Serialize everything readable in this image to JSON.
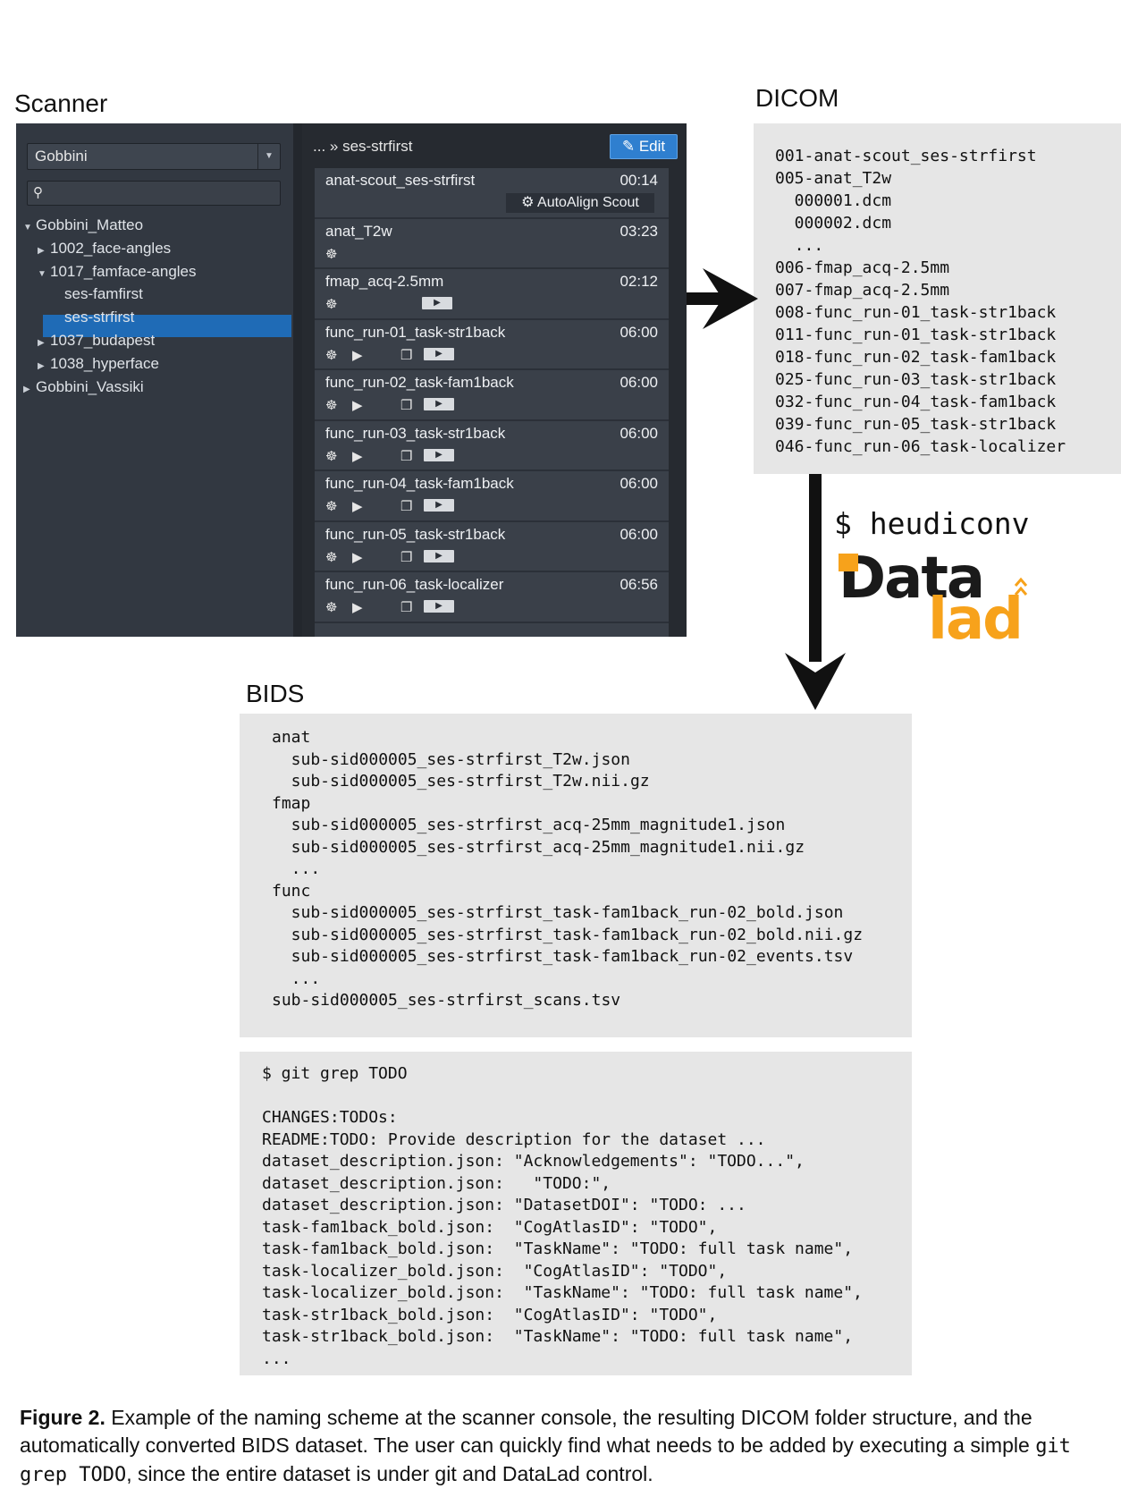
{
  "labels": {
    "scanner": "Scanner",
    "dicom": "DICOM",
    "bids": "BIDS",
    "command": "$ heudiconv"
  },
  "logo": {
    "word1": "Data",
    "word2": "lad",
    "color": "#f7a21b"
  },
  "scanner": {
    "combo_value": "Gobbini",
    "tree": [
      {
        "label": "Gobbini_Matteo",
        "expanded": true
      },
      {
        "label": "1002_face-angles",
        "expanded": false
      },
      {
        "label": "1017_famface-angles",
        "expanded": true
      },
      {
        "label": "ses-famfirst"
      },
      {
        "label": "ses-strfirst",
        "selected": true
      },
      {
        "label": "1037_budapest",
        "expanded": false
      },
      {
        "label": "1038_hyperface",
        "expanded": false
      },
      {
        "label": "Gobbini_Vassiki",
        "expanded": false
      }
    ],
    "breadcrumb": "... » ses-strfirst",
    "edit_label": "Edit",
    "autoalign_label": "AutoAlign Scout",
    "protocols": [
      {
        "name": "anat-scout_ses-strfirst",
        "time": "00:14"
      },
      {
        "name": "anat_T2w",
        "time": "03:23"
      },
      {
        "name": "fmap_acq-2.5mm",
        "time": "02:12"
      },
      {
        "name": "func_run-01_task-str1back",
        "time": "06:00"
      },
      {
        "name": "func_run-02_task-fam1back",
        "time": "06:00"
      },
      {
        "name": "func_run-03_task-str1back",
        "time": "06:00"
      },
      {
        "name": "func_run-04_task-fam1back",
        "time": "06:00"
      },
      {
        "name": "func_run-05_task-str1back",
        "time": "06:00"
      },
      {
        "name": "func_run-06_task-localizer",
        "time": "06:56"
      }
    ]
  },
  "dicom_lines": [
    "001-anat-scout_ses-strfirst",
    "005-anat_T2w",
    "  000001.dcm",
    "  000002.dcm",
    "  ...",
    "006-fmap_acq-2.5mm",
    "007-fmap_acq-2.5mm",
    "008-func_run-01_task-str1back",
    "011-func_run-01_task-str1back",
    "018-func_run-02_task-fam1back",
    "025-func_run-03_task-str1back",
    "032-func_run-04_task-fam1back",
    "039-func_run-05_task-str1back",
    "046-func_run-06_task-localizer"
  ],
  "bids_lines": [
    "anat",
    "  sub-sid000005_ses-strfirst_T2w.json",
    "  sub-sid000005_ses-strfirst_T2w.nii.gz",
    "fmap",
    "  sub-sid000005_ses-strfirst_acq-25mm_magnitude1.json",
    "  sub-sid000005_ses-strfirst_acq-25mm_magnitude1.nii.gz",
    "  ...",
    "func",
    "  sub-sid000005_ses-strfirst_task-fam1back_run-02_bold.json",
    "  sub-sid000005_ses-strfirst_task-fam1back_run-02_bold.nii.gz",
    "  sub-sid000005_ses-strfirst_task-fam1back_run-02_events.tsv",
    "  ...",
    "sub-sid000005_ses-strfirst_scans.tsv"
  ],
  "grep_lines": [
    "$ git grep TODO",
    "",
    "CHANGES:TODOs:",
    "README:TODO: Provide description for the dataset ...",
    "dataset_description.json: \"Acknowledgements\": \"TODO...\",",
    "dataset_description.json:   \"TODO:\",",
    "dataset_description.json: \"DatasetDOI\": \"TODO: ...",
    "task-fam1back_bold.json:  \"CogAtlasID\": \"TODO\",",
    "task-fam1back_bold.json:  \"TaskName\": \"TODO: full task name\",",
    "task-localizer_bold.json:  \"CogAtlasID\": \"TODO\",",
    "task-localizer_bold.json:  \"TaskName\": \"TODO: full task name\",",
    "task-str1back_bold.json:  \"CogAtlasID\": \"TODO\",",
    "task-str1back_bold.json:  \"TaskName\": \"TODO: full task name\",",
    "..."
  ],
  "caption": {
    "figure_label": "Figure 2.",
    "text_before_code": " Example of the naming scheme at the scanner console, the resulting DICOM folder structure, and the automatically converted BIDS dataset. The user can quickly find what needs to be added by executing a simple ",
    "code": "git grep TODO",
    "text_after_code": ", since the entire dataset is under git and DataLad control."
  }
}
